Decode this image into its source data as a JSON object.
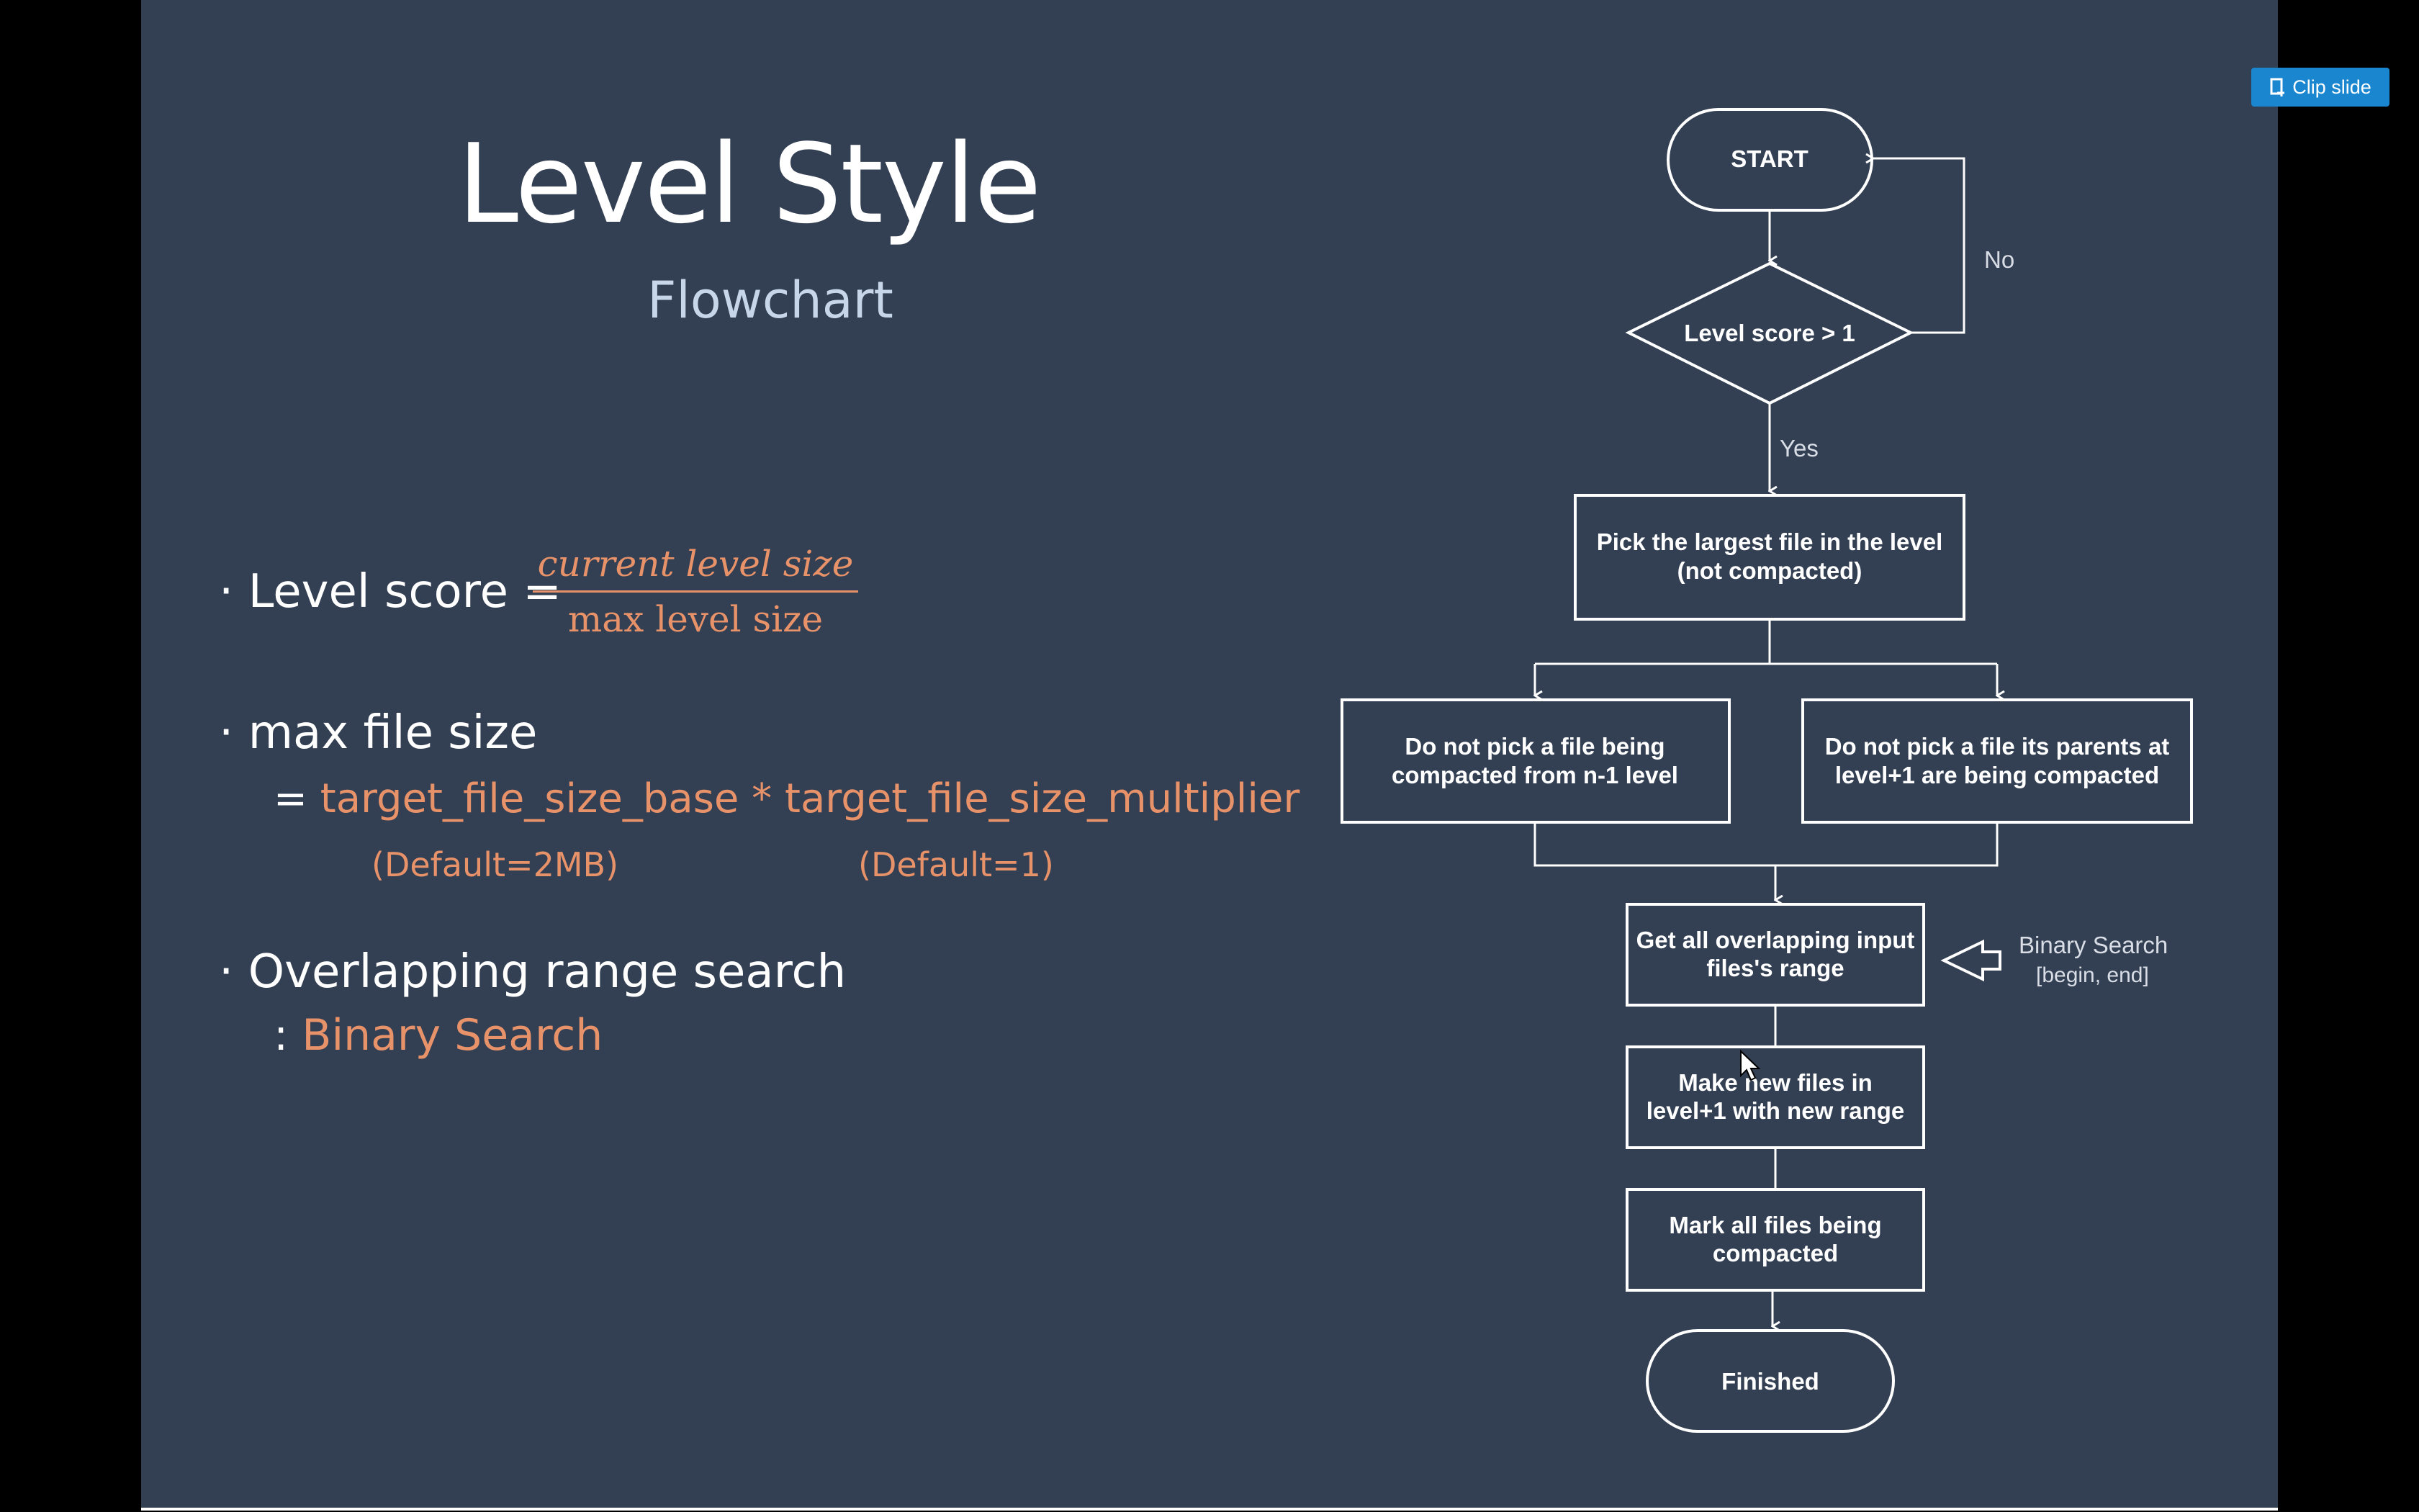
{
  "toolbar": {
    "clip_label": "Clip slide"
  },
  "slide": {
    "title": "Level Style",
    "subtitle": "Flowchart",
    "bullets": {
      "level_score": {
        "prefix": "· Level score =",
        "numerator": "current level size",
        "denominator": "max level size"
      },
      "max_file_size": {
        "prefix": "· max file size",
        "eq": "= ",
        "base": "target_file_size_base",
        "times": " * ",
        "multiplier": "target_file_size_multiplier",
        "base_default": "(Default=2MB)",
        "multiplier_default": "(Default=1)"
      },
      "overlap": {
        "prefix": "· Overlapping range search",
        "colon": ": ",
        "method": "Binary Search"
      }
    }
  },
  "flowchart": {
    "start": "START",
    "decision": "Level score > 1",
    "no_label": "No",
    "yes_label": "Yes",
    "pick_line1": "Pick the largest file in the level",
    "pick_line2": "(not compacted)",
    "left_line1": "Do not pick a file being",
    "left_line2": "compacted from n-1 level",
    "right_line1": "Do not pick a file its parents at",
    "right_line2": "level+1 are being compacted",
    "overlap_line1": "Get all overlapping input",
    "overlap_line2": "files's range",
    "binary_search_line1": "Binary Search",
    "binary_search_line2": "[begin, end]",
    "make_line1": "Make new files in",
    "make_line2": "level+1 with new range",
    "mark_line1": "Mark all files being",
    "mark_line2": "compacted",
    "finished": "Finished"
  },
  "colors": {
    "slide_background": "#333f52",
    "accent": "#e8926a",
    "subtitle": "#c8d6ea",
    "clip_button": "#1a86d0"
  }
}
